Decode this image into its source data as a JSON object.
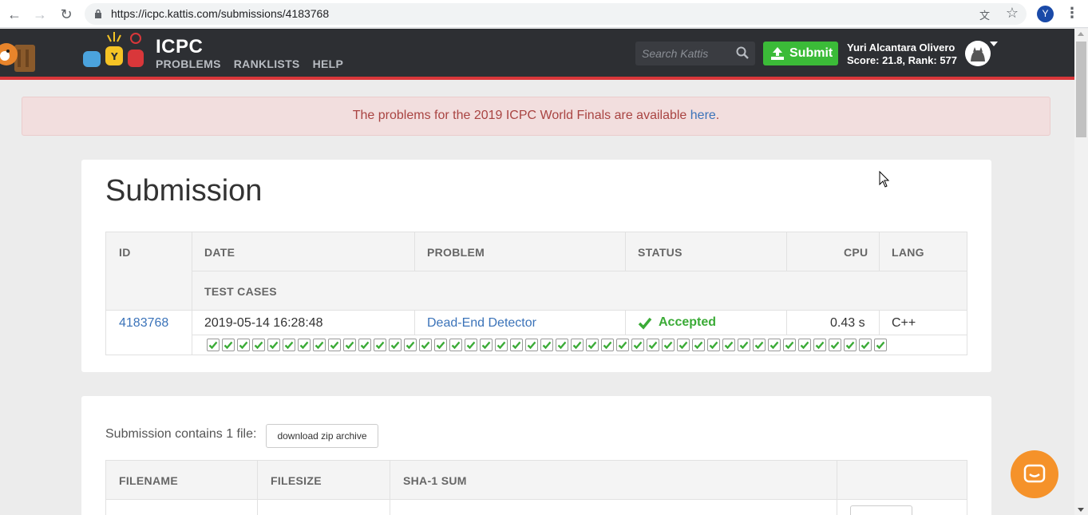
{
  "browser": {
    "url": "https://icpc.kattis.com/submissions/4183768",
    "profile_initial": "Y"
  },
  "site": {
    "title": "ICPC",
    "nav": [
      "PROBLEMS",
      "RANKLISTS",
      "HELP"
    ],
    "search_placeholder": "Search Kattis",
    "submit_label": "Submit",
    "user_name": "Yuri Alcantara Olivero",
    "user_score": "Score: 21.8, Rank: 577"
  },
  "alert": {
    "text": "The problems for the 2019 ICPC World Finals are available ",
    "link": "here",
    "end": "."
  },
  "submission": {
    "heading": "Submission",
    "columns": {
      "id": "ID",
      "date": "DATE",
      "problem": "PROBLEM",
      "status": "STATUS",
      "cpu": "CPU",
      "lang": "LANG",
      "test_cases": "TEST CASES"
    },
    "row": {
      "id": "4183768",
      "date": "2019-05-14 16:28:48",
      "problem": "Dead-End Detector",
      "status": "Accepted",
      "cpu": "0.43 s",
      "lang": "C++"
    },
    "test_case_count": 45
  },
  "files": {
    "contains_text": "Submission contains 1 file:",
    "download_label": "download zip archive",
    "columns": {
      "filename": "FILENAME",
      "filesize": "FILESIZE",
      "sha1": "SHA-1 SUM"
    }
  },
  "colors": {
    "accent_green": "#3bbb38",
    "header_bg": "#2d2f33",
    "header_line": "#d9373a",
    "link": "#3b73b9",
    "chat": "#f5922a"
  }
}
